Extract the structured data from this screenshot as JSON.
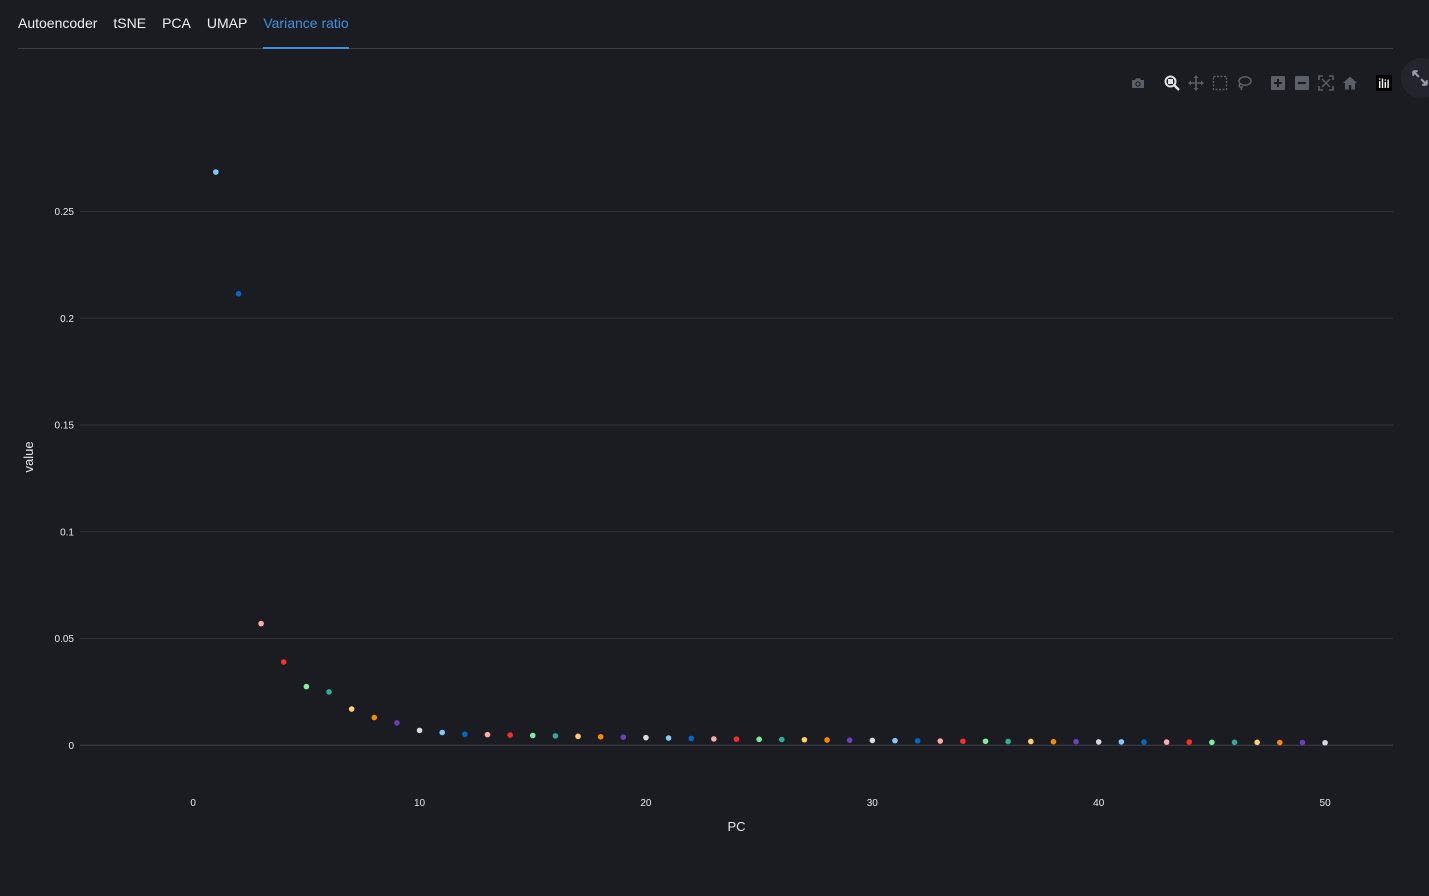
{
  "tabs": [
    {
      "label": "Autoencoder",
      "active": false
    },
    {
      "label": "tSNE",
      "active": false
    },
    {
      "label": "PCA",
      "active": false
    },
    {
      "label": "UMAP",
      "active": false
    },
    {
      "label": "Variance ratio",
      "active": true
    }
  ],
  "modebar": {
    "icons": [
      "camera-icon",
      "zoom-icon",
      "pan-icon",
      "box-select-icon",
      "lasso-select-icon",
      "zoom-in-icon",
      "zoom-out-icon",
      "autoscale-icon",
      "reset-axes-icon",
      "plotly-logo-icon"
    ]
  },
  "fullscreen_icon": "expand-icon",
  "colors": {
    "accent": "#3d8fe0",
    "background": "#1a1c21",
    "palette": [
      "#83c9ff",
      "#0068c9",
      "#ffabab",
      "#ff2b2b",
      "#7defa1",
      "#29b09d",
      "#ffd16a",
      "#ff8700",
      "#6d3fc0",
      "#d5dae5"
    ]
  },
  "chart_data": {
    "type": "scatter",
    "xlabel": "PC",
    "ylabel": "value",
    "xlim": [
      -5,
      53
    ],
    "ylim": [
      -0.0125,
      0.2835
    ],
    "xticks": [
      0,
      10,
      20,
      30,
      40,
      50
    ],
    "yticks": [
      0,
      0.05,
      0.1,
      0.15,
      0.2,
      0.25
    ],
    "ytick_labels": [
      "0",
      "0.05",
      "0.1",
      "0.15",
      "0.2",
      "0.25"
    ],
    "grid": true,
    "legend": "none",
    "x": [
      1,
      2,
      3,
      4,
      5,
      6,
      7,
      8,
      9,
      10,
      11,
      12,
      13,
      14,
      15,
      16,
      17,
      18,
      19,
      20,
      21,
      22,
      23,
      24,
      25,
      26,
      27,
      28,
      29,
      30,
      31,
      32,
      33,
      34,
      35,
      36,
      37,
      38,
      39,
      40,
      41,
      42,
      43,
      44,
      45,
      46,
      47,
      48,
      49,
      50
    ],
    "y": [
      0.2685,
      0.2115,
      0.057,
      0.039,
      0.0275,
      0.025,
      0.017,
      0.013,
      0.0105,
      0.007,
      0.006,
      0.0052,
      0.005,
      0.0048,
      0.0046,
      0.0044,
      0.0042,
      0.004,
      0.0038,
      0.0036,
      0.0034,
      0.0032,
      0.003,
      0.0029,
      0.0028,
      0.0027,
      0.0026,
      0.0025,
      0.0024,
      0.0023,
      0.0022,
      0.0021,
      0.002,
      0.0019,
      0.0019,
      0.0018,
      0.0018,
      0.0017,
      0.0017,
      0.0016,
      0.0016,
      0.0015,
      0.0015,
      0.0015,
      0.0014,
      0.0014,
      0.0014,
      0.0013,
      0.0013,
      0.0012
    ]
  }
}
